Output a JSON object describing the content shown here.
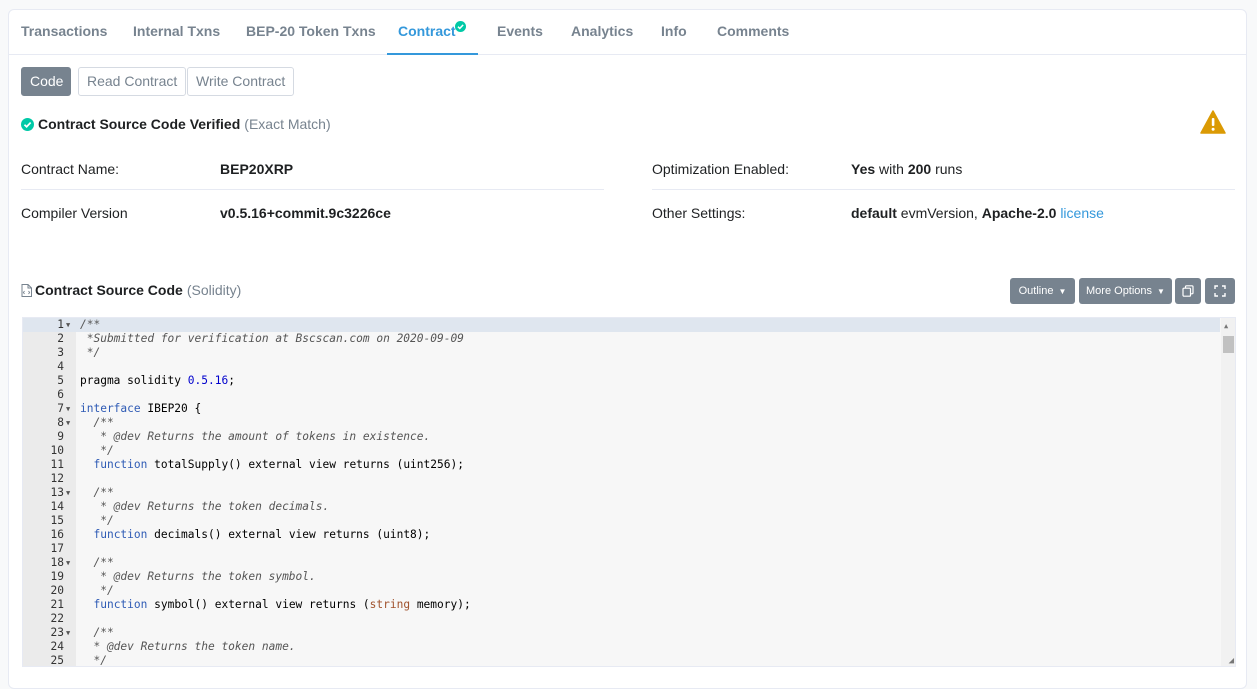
{
  "tabs": [
    {
      "label": "Transactions"
    },
    {
      "label": "Internal Txns"
    },
    {
      "label": "BEP-20 Token Txns"
    },
    {
      "label": "Contract"
    },
    {
      "label": "Events"
    },
    {
      "label": "Analytics"
    },
    {
      "label": "Info"
    },
    {
      "label": "Comments"
    }
  ],
  "subtabs": {
    "code": "Code",
    "read": "Read Contract",
    "write": "Write Contract"
  },
  "verified": {
    "title": "Contract Source Code Verified",
    "match": "(Exact Match)"
  },
  "info": {
    "contract_name_label": "Contract Name:",
    "contract_name": "BEP20XRP",
    "compiler_label": "Compiler Version",
    "compiler": "v0.5.16+commit.9c3226ce",
    "optimization_label": "Optimization Enabled:",
    "optimization_yes": "Yes",
    "optimization_with": "with",
    "optimization_runs": "200",
    "optimization_runs_word": "runs",
    "other_label": "Other Settings:",
    "other_default": "default",
    "other_evm": "evmVersion,",
    "other_license": "Apache-2.0",
    "other_license_link": "license"
  },
  "source": {
    "title": "Contract Source Code",
    "lang": "(Solidity)",
    "outline": "Outline",
    "more_options": "More Options"
  },
  "code_lines": [
    {
      "n": "1",
      "fold": true,
      "segs": [
        [
          "c",
          "/**"
        ]
      ]
    },
    {
      "n": "2",
      "segs": [
        [
          "c",
          " *Submitted for verification at Bscscan.com on 2020-09-09"
        ]
      ]
    },
    {
      "n": "3",
      "segs": [
        [
          "c",
          " */"
        ]
      ]
    },
    {
      "n": "4",
      "segs": []
    },
    {
      "n": "5",
      "segs": [
        [
          "p",
          "pragma solidity "
        ],
        [
          "n",
          "0.5.16"
        ],
        [
          "p",
          ";"
        ]
      ]
    },
    {
      "n": "6",
      "segs": []
    },
    {
      "n": "7",
      "fold": true,
      "segs": [
        [
          "k",
          "interface"
        ],
        [
          "p",
          " IBEP20 {"
        ]
      ]
    },
    {
      "n": "8",
      "fold": true,
      "segs": [
        [
          "c",
          "  /**"
        ]
      ]
    },
    {
      "n": "9",
      "segs": [
        [
          "c",
          "   * @dev Returns the amount of tokens in existence."
        ]
      ]
    },
    {
      "n": "10",
      "segs": [
        [
          "c",
          "   */"
        ]
      ]
    },
    {
      "n": "11",
      "segs": [
        [
          "p",
          "  "
        ],
        [
          "k",
          "function"
        ],
        [
          "p",
          " totalSupply() external view returns (uint256);"
        ]
      ]
    },
    {
      "n": "12",
      "segs": []
    },
    {
      "n": "13",
      "fold": true,
      "segs": [
        [
          "c",
          "  /**"
        ]
      ]
    },
    {
      "n": "14",
      "segs": [
        [
          "c",
          "   * @dev Returns the token decimals."
        ]
      ]
    },
    {
      "n": "15",
      "segs": [
        [
          "c",
          "   */"
        ]
      ]
    },
    {
      "n": "16",
      "segs": [
        [
          "p",
          "  "
        ],
        [
          "k",
          "function"
        ],
        [
          "p",
          " decimals() external view returns (uint8);"
        ]
      ]
    },
    {
      "n": "17",
      "segs": []
    },
    {
      "n": "18",
      "fold": true,
      "segs": [
        [
          "c",
          "  /**"
        ]
      ]
    },
    {
      "n": "19",
      "segs": [
        [
          "c",
          "   * @dev Returns the token symbol."
        ]
      ]
    },
    {
      "n": "20",
      "segs": [
        [
          "c",
          "   */"
        ]
      ]
    },
    {
      "n": "21",
      "segs": [
        [
          "p",
          "  "
        ],
        [
          "k",
          "function"
        ],
        [
          "p",
          " symbol() external view returns ("
        ],
        [
          "t",
          "string"
        ],
        [
          "p",
          " memory);"
        ]
      ]
    },
    {
      "n": "22",
      "segs": []
    },
    {
      "n": "23",
      "fold": true,
      "segs": [
        [
          "c",
          "  /**"
        ]
      ]
    },
    {
      "n": "24",
      "segs": [
        [
          "c",
          "  * @dev Returns the token name."
        ]
      ]
    },
    {
      "n": "25",
      "segs": [
        [
          "c",
          "  */"
        ]
      ]
    }
  ],
  "colors": {
    "accent": "#3498db",
    "verified": "#00c9a7",
    "warning": "#db9a04",
    "muted": "#77838f"
  }
}
